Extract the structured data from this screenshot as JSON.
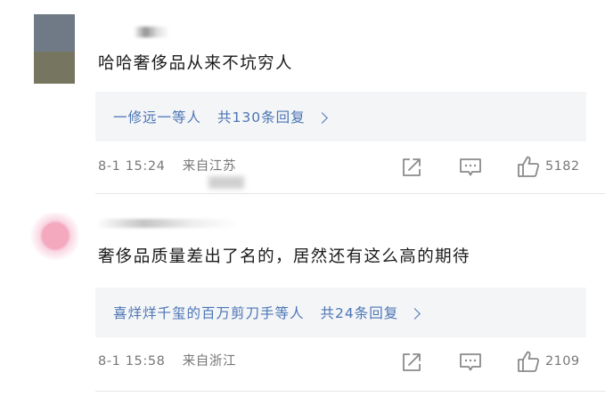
{
  "comments": [
    {
      "text": "哈哈奢侈品从来不坑穷人",
      "reply_users": "一修远一等人",
      "reply_count": "共130条回复",
      "date": "8-1 15:24",
      "location": "来自江苏",
      "likes": "5182",
      "icons": [
        "share-icon",
        "comment-icon",
        "like-icon",
        "chevron-right-icon"
      ]
    },
    {
      "text": "奢侈品质量差出了名的，居然还有这么高的期待",
      "reply_users": "喜烊烊千玺的百万剪刀手等人",
      "reply_count": "共24条回复",
      "date": "8-1 15:58",
      "location": "来自浙江",
      "likes": "2109",
      "icons": [
        "share-icon",
        "comment-icon",
        "like-icon",
        "chevron-right-icon"
      ]
    }
  ],
  "colors": {
    "link": "#4a74b5",
    "meta": "#777777",
    "reply_bg": "#f4f5f7",
    "text": "#1a1a1a"
  }
}
